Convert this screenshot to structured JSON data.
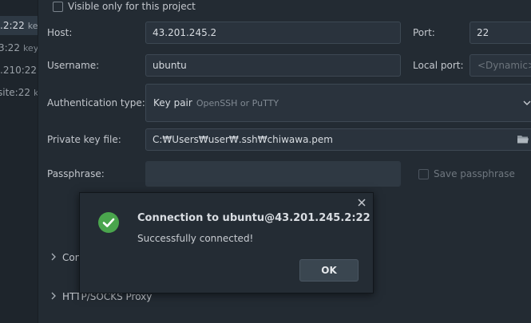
{
  "left_list": {
    "items": [
      {
        "label": ".2:22",
        "suffix": "key"
      },
      {
        "label": "3:22",
        "suffix": "key"
      },
      {
        "label": ".210:22",
        "suffix": "k"
      },
      {
        "label": "site:22",
        "suffix": "ke"
      }
    ]
  },
  "visible_only": {
    "label": "Visible only for this project"
  },
  "host": {
    "label": "Host:",
    "value": "43.201.245.2"
  },
  "port": {
    "label": "Port:",
    "value": "22"
  },
  "username": {
    "label": "Username:",
    "value": "ubuntu"
  },
  "local_port": {
    "label": "Local port:",
    "placeholder": "<Dynamic>"
  },
  "auth": {
    "label": "Authentication type:",
    "value": "Key pair",
    "hint": "OpenSSH or PuTTY"
  },
  "private_key": {
    "label": "Private key file:",
    "value": "C:₩Users₩user₩.ssh₩chiwawa.pem"
  },
  "passphrase": {
    "label": "Passphrase:",
    "save_label": "Save passphrase"
  },
  "sections": {
    "connection": "Con",
    "proxy": "HTTP/SOCKS Proxy"
  },
  "dialog": {
    "title": "Connection to ubuntu@43.201.245.2:22",
    "message": "Successfully connected!",
    "ok_label": "OK"
  },
  "colors": {
    "success_green": "#4aa54d",
    "background": "#232b33",
    "field_background": "#2a333d"
  }
}
